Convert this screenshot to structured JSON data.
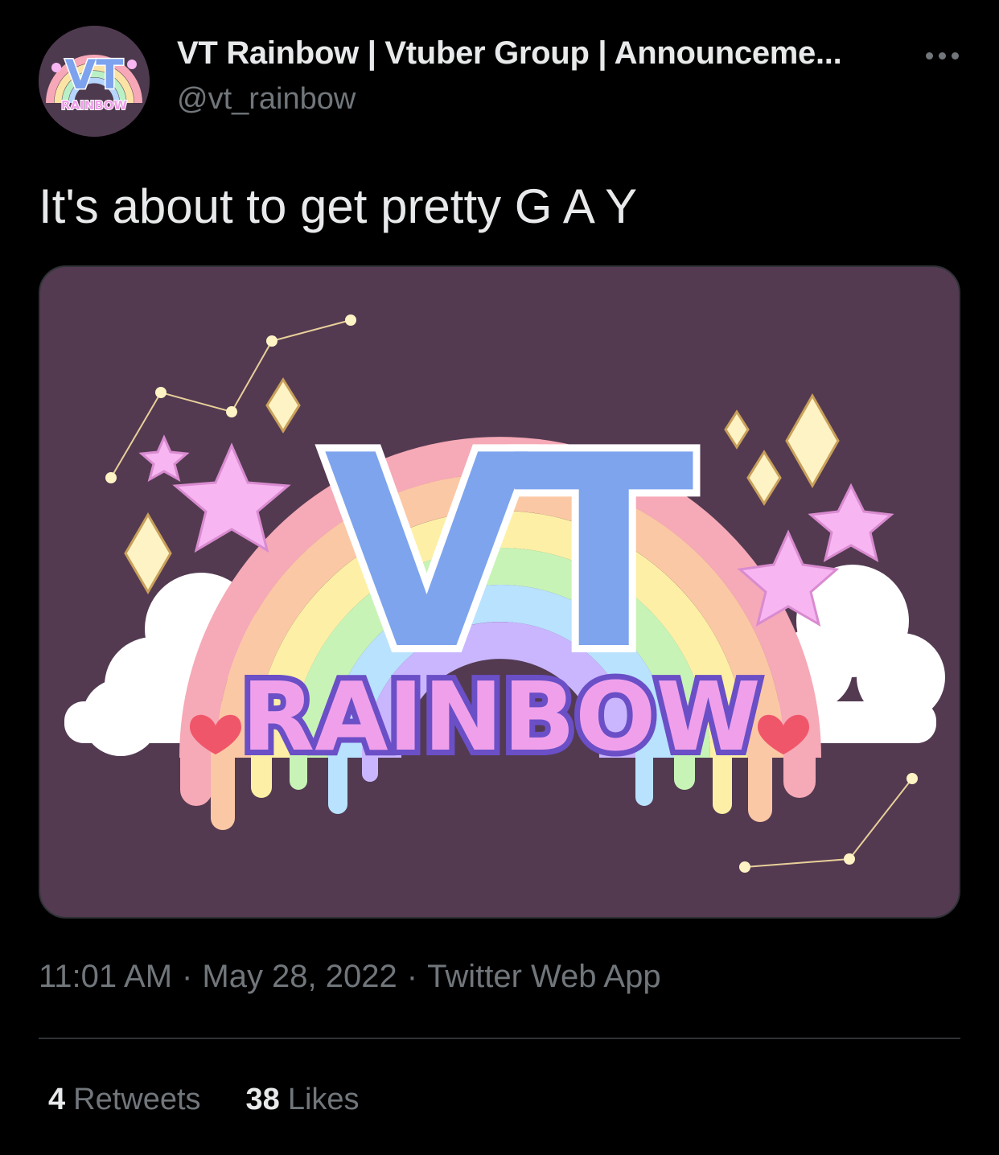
{
  "author": {
    "display_name": "VT Rainbow | Vtuber Group | Announceme...",
    "handle": "@vt_rainbow",
    "avatar_logo_text": "VT",
    "avatar_logo_subtext": "RAINBOW"
  },
  "tweet": {
    "text": "It's about to get pretty G A Y",
    "media": {
      "logo_text": "VT",
      "logo_subtext": "RAINBOW",
      "background_color": "#533a51"
    },
    "time": "11:01 AM",
    "date": "May 28, 2022",
    "source": "Twitter Web App",
    "separator": "·"
  },
  "stats": {
    "retweets_count": "4",
    "retweets_label": "Retweets",
    "likes_count": "38",
    "likes_label": "Likes"
  },
  "icons": {
    "more": "more-options-icon"
  },
  "colors": {
    "background": "#000000",
    "primary_text": "#e7e9ea",
    "secondary_text": "#71767b",
    "border": "#2f3336"
  }
}
